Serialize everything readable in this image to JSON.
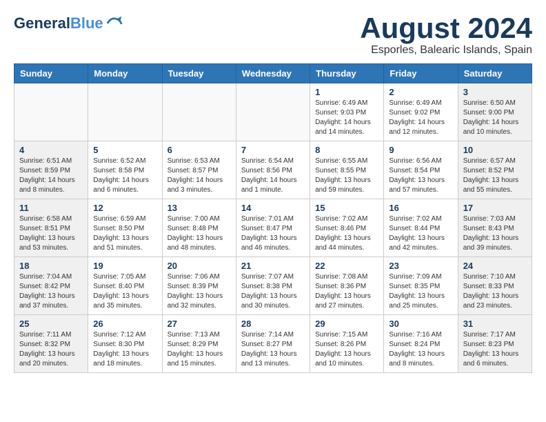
{
  "header": {
    "logo_line1": "General",
    "logo_line2": "Blue",
    "month_title": "August 2024",
    "subtitle": "Esporles, Balearic Islands, Spain"
  },
  "weekdays": [
    "Sunday",
    "Monday",
    "Tuesday",
    "Wednesday",
    "Thursday",
    "Friday",
    "Saturday"
  ],
  "weeks": [
    [
      {
        "day": "",
        "info": ""
      },
      {
        "day": "",
        "info": ""
      },
      {
        "day": "",
        "info": ""
      },
      {
        "day": "",
        "info": ""
      },
      {
        "day": "1",
        "info": "Sunrise: 6:49 AM\nSunset: 9:03 PM\nDaylight: 14 hours\nand 14 minutes."
      },
      {
        "day": "2",
        "info": "Sunrise: 6:49 AM\nSunset: 9:02 PM\nDaylight: 14 hours\nand 12 minutes."
      },
      {
        "day": "3",
        "info": "Sunrise: 6:50 AM\nSunset: 9:00 PM\nDaylight: 14 hours\nand 10 minutes."
      }
    ],
    [
      {
        "day": "4",
        "info": "Sunrise: 6:51 AM\nSunset: 8:59 PM\nDaylight: 14 hours\nand 8 minutes."
      },
      {
        "day": "5",
        "info": "Sunrise: 6:52 AM\nSunset: 8:58 PM\nDaylight: 14 hours\nand 6 minutes."
      },
      {
        "day": "6",
        "info": "Sunrise: 6:53 AM\nSunset: 8:57 PM\nDaylight: 14 hours\nand 3 minutes."
      },
      {
        "day": "7",
        "info": "Sunrise: 6:54 AM\nSunset: 8:56 PM\nDaylight: 14 hours\nand 1 minute."
      },
      {
        "day": "8",
        "info": "Sunrise: 6:55 AM\nSunset: 8:55 PM\nDaylight: 13 hours\nand 59 minutes."
      },
      {
        "day": "9",
        "info": "Sunrise: 6:56 AM\nSunset: 8:54 PM\nDaylight: 13 hours\nand 57 minutes."
      },
      {
        "day": "10",
        "info": "Sunrise: 6:57 AM\nSunset: 8:52 PM\nDaylight: 13 hours\nand 55 minutes."
      }
    ],
    [
      {
        "day": "11",
        "info": "Sunrise: 6:58 AM\nSunset: 8:51 PM\nDaylight: 13 hours\nand 53 minutes."
      },
      {
        "day": "12",
        "info": "Sunrise: 6:59 AM\nSunset: 8:50 PM\nDaylight: 13 hours\nand 51 minutes."
      },
      {
        "day": "13",
        "info": "Sunrise: 7:00 AM\nSunset: 8:48 PM\nDaylight: 13 hours\nand 48 minutes."
      },
      {
        "day": "14",
        "info": "Sunrise: 7:01 AM\nSunset: 8:47 PM\nDaylight: 13 hours\nand 46 minutes."
      },
      {
        "day": "15",
        "info": "Sunrise: 7:02 AM\nSunset: 8:46 PM\nDaylight: 13 hours\nand 44 minutes."
      },
      {
        "day": "16",
        "info": "Sunrise: 7:02 AM\nSunset: 8:44 PM\nDaylight: 13 hours\nand 42 minutes."
      },
      {
        "day": "17",
        "info": "Sunrise: 7:03 AM\nSunset: 8:43 PM\nDaylight: 13 hours\nand 39 minutes."
      }
    ],
    [
      {
        "day": "18",
        "info": "Sunrise: 7:04 AM\nSunset: 8:42 PM\nDaylight: 13 hours\nand 37 minutes."
      },
      {
        "day": "19",
        "info": "Sunrise: 7:05 AM\nSunset: 8:40 PM\nDaylight: 13 hours\nand 35 minutes."
      },
      {
        "day": "20",
        "info": "Sunrise: 7:06 AM\nSunset: 8:39 PM\nDaylight: 13 hours\nand 32 minutes."
      },
      {
        "day": "21",
        "info": "Sunrise: 7:07 AM\nSunset: 8:38 PM\nDaylight: 13 hours\nand 30 minutes."
      },
      {
        "day": "22",
        "info": "Sunrise: 7:08 AM\nSunset: 8:36 PM\nDaylight: 13 hours\nand 27 minutes."
      },
      {
        "day": "23",
        "info": "Sunrise: 7:09 AM\nSunset: 8:35 PM\nDaylight: 13 hours\nand 25 minutes."
      },
      {
        "day": "24",
        "info": "Sunrise: 7:10 AM\nSunset: 8:33 PM\nDaylight: 13 hours\nand 23 minutes."
      }
    ],
    [
      {
        "day": "25",
        "info": "Sunrise: 7:11 AM\nSunset: 8:32 PM\nDaylight: 13 hours\nand 20 minutes."
      },
      {
        "day": "26",
        "info": "Sunrise: 7:12 AM\nSunset: 8:30 PM\nDaylight: 13 hours\nand 18 minutes."
      },
      {
        "day": "27",
        "info": "Sunrise: 7:13 AM\nSunset: 8:29 PM\nDaylight: 13 hours\nand 15 minutes."
      },
      {
        "day": "28",
        "info": "Sunrise: 7:14 AM\nSunset: 8:27 PM\nDaylight: 13 hours\nand 13 minutes."
      },
      {
        "day": "29",
        "info": "Sunrise: 7:15 AM\nSunset: 8:26 PM\nDaylight: 13 hours\nand 10 minutes."
      },
      {
        "day": "30",
        "info": "Sunrise: 7:16 AM\nSunset: 8:24 PM\nDaylight: 13 hours\nand 8 minutes."
      },
      {
        "day": "31",
        "info": "Sunrise: 7:17 AM\nSunset: 8:23 PM\nDaylight: 13 hours\nand 6 minutes."
      }
    ]
  ]
}
